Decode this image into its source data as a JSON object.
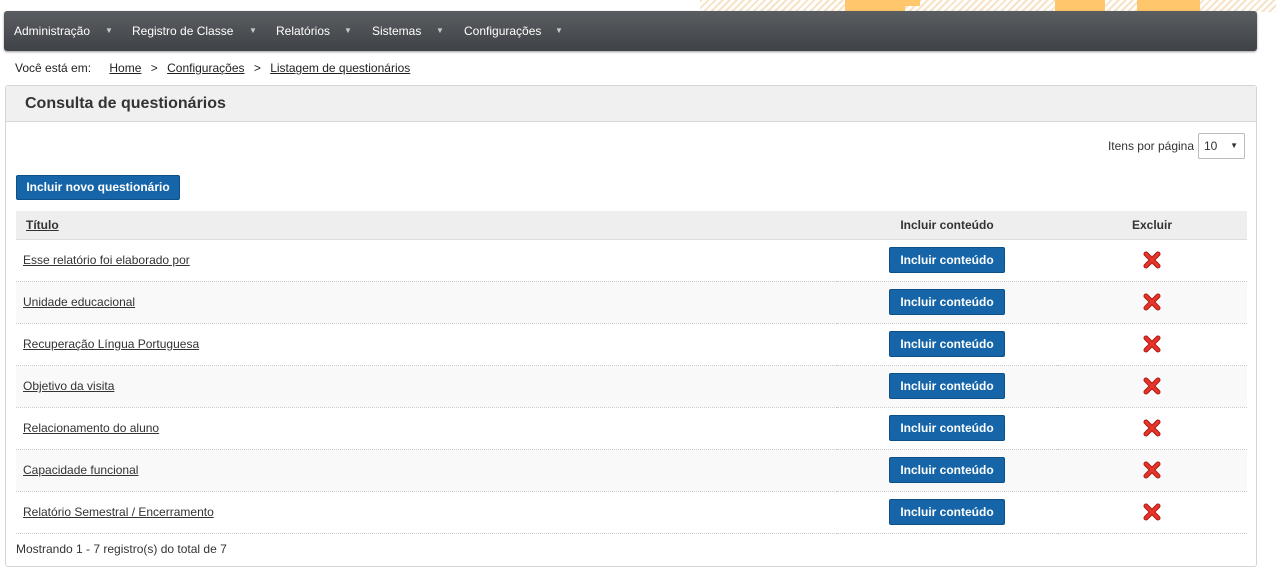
{
  "nav": {
    "items": [
      "Administração",
      "Registro de Classe",
      "Relatórios",
      "Sistemas",
      "Configurações"
    ],
    "caret": "▼"
  },
  "breadcrumb": {
    "lead": "Você está em:",
    "links": [
      "Home",
      "Configurações",
      "Listagem de questionários"
    ],
    "separator": ">"
  },
  "panel": {
    "title": "Consulta de questionários"
  },
  "perpage": {
    "label": "Itens por página",
    "value": "10"
  },
  "actions": {
    "new_label": "Incluir novo questionário"
  },
  "table": {
    "headers": {
      "title": "Título",
      "content": "Incluir conteúdo",
      "delete": "Excluir"
    },
    "row_button_label": "Incluir conteúdo",
    "rows": [
      "Esse relatório foi elaborado por",
      "Unidade educacional",
      "Recuperação Língua Portuguesa",
      "Objetivo da visita",
      "Relacionamento do aluno",
      "Capacidade funcional",
      "Relatório Semestral / Encerramento"
    ]
  },
  "footer": {
    "count_text": "Mostrando 1 - 7 registro(s) do total de 7"
  },
  "icons": {
    "delete": "red-x-icon",
    "dropdown": "caret-down-icon"
  },
  "colors": {
    "primary": "#1565a8",
    "navbar": "#4a4d51",
    "delete": "#d6261b",
    "accent": "#ffc66b"
  }
}
